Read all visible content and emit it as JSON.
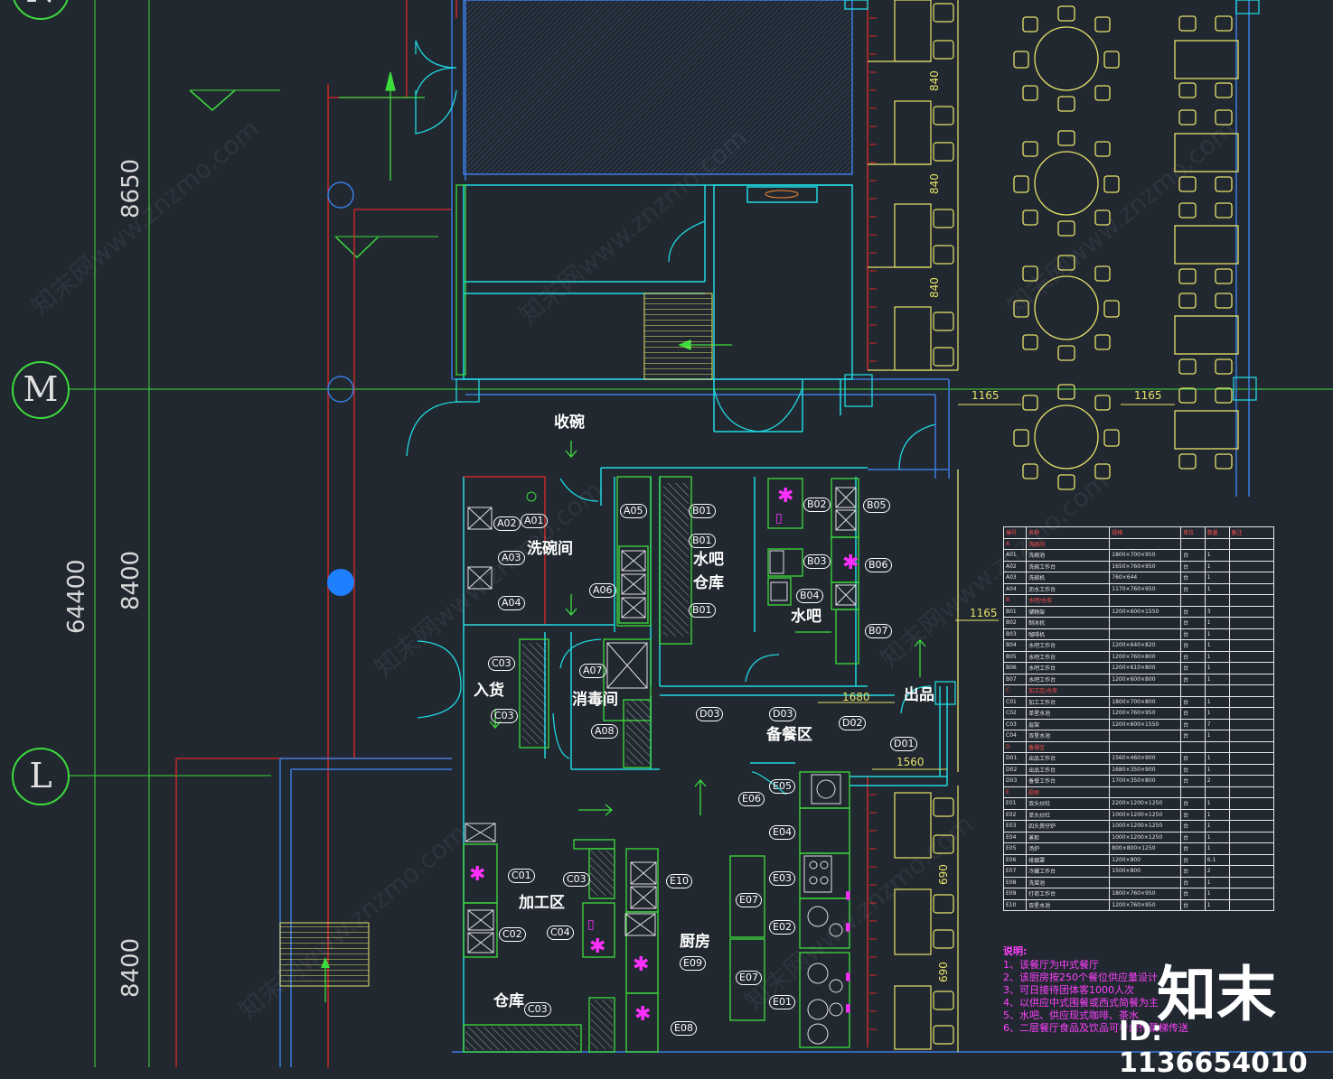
{
  "grid_labels": [
    "M",
    "L",
    "N"
  ],
  "dims_vertical_big": [
    "8650",
    "8400",
    "64400",
    "8400"
  ],
  "dims_small_vertical": [
    "840",
    "840",
    "840",
    "690",
    "690"
  ],
  "dims_small_horizontal": [
    "1165",
    "1165",
    "1165",
    "1680",
    "1560"
  ],
  "rooms": {
    "shouwan": "收碗",
    "xiwanjian": "洗碗间",
    "shuiba_cangku": "水吧\n仓库",
    "shuiba": "水吧",
    "ruhuo": "入货",
    "xiaodujian": "消毒间",
    "chupin": "出品",
    "beicanqu": "备餐区",
    "jiagongqu": "加工区",
    "chufang": "厨房",
    "cangku": "仓库"
  },
  "tags": [
    "A02",
    "A01",
    "A03",
    "A04",
    "A05",
    "A06",
    "A07",
    "A08",
    "B01",
    "B01",
    "B01",
    "B02",
    "B05",
    "B03",
    "B06",
    "B04",
    "B07",
    "C03",
    "C03",
    "C01",
    "C02",
    "C03",
    "C04",
    "C03",
    "D03",
    "D03",
    "D02",
    "D01",
    "E05",
    "E06",
    "E04",
    "E03",
    "E07",
    "E02",
    "E07",
    "E01",
    "E10",
    "E09",
    "E08"
  ],
  "spec_table": {
    "header": [
      "编号",
      "名称",
      "规格",
      "单位",
      "数量",
      "备注"
    ],
    "rows": [
      [
        "A",
        "洗碗间",
        "",
        "",
        "",
        ""
      ],
      [
        "A01",
        "洗碗池",
        "1800×700×950",
        "台",
        "1",
        ""
      ],
      [
        "A02",
        "洗碗工作台",
        "1650×760×950",
        "台",
        "1",
        ""
      ],
      [
        "A03",
        "洗碗机",
        "760×644",
        "台",
        "1",
        ""
      ],
      [
        "A04",
        "沥水工作台",
        "1170×760×950",
        "台",
        "1",
        ""
      ],
      [
        "B",
        "水吧/仓库",
        "",
        "",
        "",
        ""
      ],
      [
        "B01",
        "储物架",
        "1200×600×1550",
        "台",
        "3",
        ""
      ],
      [
        "B02",
        "制冰机",
        "",
        "台",
        "1",
        ""
      ],
      [
        "B03",
        "咖啡机",
        "",
        "台",
        "1",
        ""
      ],
      [
        "B04",
        "水吧工作台",
        "1200×640×820",
        "台",
        "1",
        ""
      ],
      [
        "B05",
        "水吧工作台",
        "1200×760×800",
        "台",
        "1",
        ""
      ],
      [
        "B06",
        "水吧工作台",
        "1200×610×800",
        "台",
        "1",
        ""
      ],
      [
        "B07",
        "水吧工作台",
        "1200×600×800",
        "台",
        "1",
        ""
      ],
      [
        "C",
        "加工区/仓库",
        "",
        "",
        "",
        ""
      ],
      [
        "C01",
        "加工工作台",
        "1800×700×800",
        "台",
        "1",
        ""
      ],
      [
        "C02",
        "单星水池",
        "1200×760×950",
        "台",
        "1",
        ""
      ],
      [
        "C03",
        "层架",
        "1200×600×1550",
        "台",
        "7",
        ""
      ],
      [
        "C04",
        "双星水池",
        "",
        "台",
        "1",
        ""
      ],
      [
        "D",
        "备餐区",
        "",
        "",
        "",
        ""
      ],
      [
        "D01",
        "出品工作台",
        "1560×460×900",
        "台",
        "1",
        ""
      ],
      [
        "D02",
        "出品工作台",
        "1680×350×900",
        "台",
        "1",
        ""
      ],
      [
        "D03",
        "备餐工作台",
        "1700×350×800",
        "台",
        "2",
        ""
      ],
      [
        "E",
        "厨房",
        "",
        "",
        "",
        ""
      ],
      [
        "E01",
        "双头炒灶",
        "2200×1200×1250",
        "台",
        "1",
        ""
      ],
      [
        "E02",
        "单头炒灶",
        "1000×1200×1250",
        "台",
        "1",
        ""
      ],
      [
        "E03",
        "四头煲仔炉",
        "1000×1200×1250",
        "台",
        "1",
        ""
      ],
      [
        "E04",
        "蒸柜",
        "1000×1200×1250",
        "台",
        "1",
        ""
      ],
      [
        "E05",
        "汤炉",
        "800×800×1250",
        "台",
        "1",
        ""
      ],
      [
        "E06",
        "排烟罩",
        "1200×800",
        "台",
        "6.1",
        ""
      ],
      [
        "E07",
        "冷藏工作台",
        "1500×800",
        "台",
        "2",
        ""
      ],
      [
        "E08",
        "洗菜池",
        "",
        "台",
        "1",
        ""
      ],
      [
        "E09",
        "打荷工作台",
        "1800×760×950",
        "台",
        "1",
        ""
      ],
      [
        "E10",
        "双星水池",
        "1200×760×950",
        "台",
        "1",
        ""
      ]
    ]
  },
  "notes": {
    "title": "说明:",
    "lines": [
      "1、该餐厅为中式餐厅",
      "2、该厨房按250个餐位供应量设计",
      "3、可日接待团体客1000人次",
      "4、以供应中式围餐或西式简餐为主",
      "5、水吧、供应现式咖啡、茶水",
      "6、二层餐厅食品及饮品可考虑传菜梯传送"
    ]
  },
  "watermark": {
    "logo": "知末",
    "image_id": "ID: 1136654010",
    "site": "知末网www.znzmo.com"
  },
  "colors": {
    "background": "#212830",
    "wall_cyan": "#20d8e0",
    "wall_green": "#3ddc3d",
    "wall_blue": "#3a7be0",
    "red_line": "#e02828",
    "furniture_yellow": "#e8e26a",
    "magenta": "#ff30ff"
  }
}
